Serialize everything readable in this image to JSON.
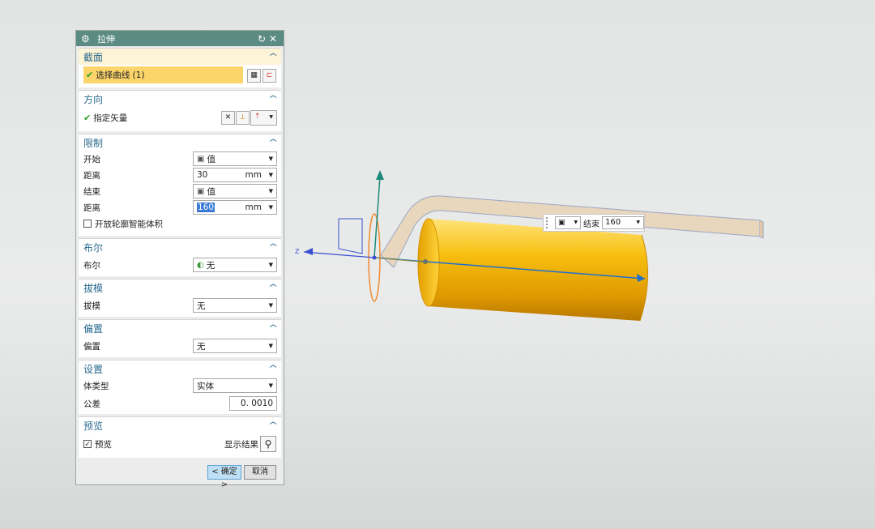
{
  "dialog": {
    "title": "拉伸",
    "reset_icon": "reset-icon",
    "close_icon": "close-icon",
    "sections": {
      "section": {
        "title": "截面",
        "select_curve": "选择曲线 (1)"
      },
      "direction": {
        "title": "方向",
        "specify_vector": "指定矢量"
      },
      "limits": {
        "title": "限制",
        "start_label": "开始",
        "start_value": "值",
        "distance1_label": "距离",
        "distance1_value": "30",
        "distance1_unit": "mm",
        "end_label": "结束",
        "end_value": "值",
        "distance2_label": "距离",
        "distance2_value": "160",
        "distance2_unit": "mm",
        "open_profile": "开放轮廓智能体积"
      },
      "boolean": {
        "title": "布尔",
        "label": "布尔",
        "value": "无"
      },
      "draft": {
        "title": "拔模",
        "label": "拔模",
        "value": "无"
      },
      "offset": {
        "title": "偏置",
        "label": "偏置",
        "value": "无"
      },
      "settings": {
        "title": "设置",
        "body_type_label": "体类型",
        "body_type_value": "实体",
        "tolerance_label": "公差",
        "tolerance_value": "0. 0010"
      },
      "preview": {
        "title": "预览",
        "preview_label": "预览",
        "show_result": "显示结果"
      }
    },
    "ok_label": "< 确定 >",
    "cancel_label": "取消"
  },
  "viewport": {
    "axis_label": "Z",
    "float_input": {
      "label": "结束",
      "value": "160"
    }
  },
  "colors": {
    "titlebar": "#5b8b82",
    "section_title": "#2a6a8e",
    "highlight": "#fbd46a",
    "cylinder": "#f2b200",
    "axis": "#1e6fd0"
  }
}
